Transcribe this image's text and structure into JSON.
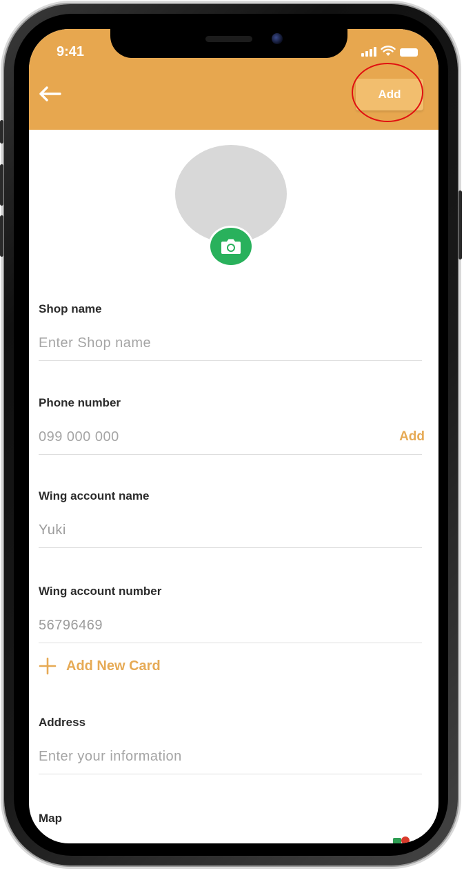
{
  "status_bar": {
    "time": "9:41"
  },
  "header": {
    "add_label": "Add",
    "background": "#e7a74f",
    "back_icon": "arrow-left-icon"
  },
  "profile": {
    "camera_icon": "camera-icon",
    "camera_color": "#29b15c"
  },
  "form": {
    "shop_name": {
      "label": "Shop name",
      "placeholder": "Enter Shop name"
    },
    "phone_number": {
      "label": "Phone number",
      "placeholder": "099 000 000",
      "add_label": "Add"
    },
    "wing_account_name": {
      "label": "Wing account name",
      "value": "Yuki"
    },
    "wing_account_number": {
      "label": "Wing account number",
      "value": "56796469"
    },
    "add_card": {
      "label": "Add New Card",
      "icon": "plus-icon"
    },
    "address": {
      "label": "Address",
      "placeholder": "Enter your information"
    },
    "map": {
      "label": "Map"
    }
  },
  "colors": {
    "accent": "#e6aa55",
    "annotation": "#e01010"
  }
}
